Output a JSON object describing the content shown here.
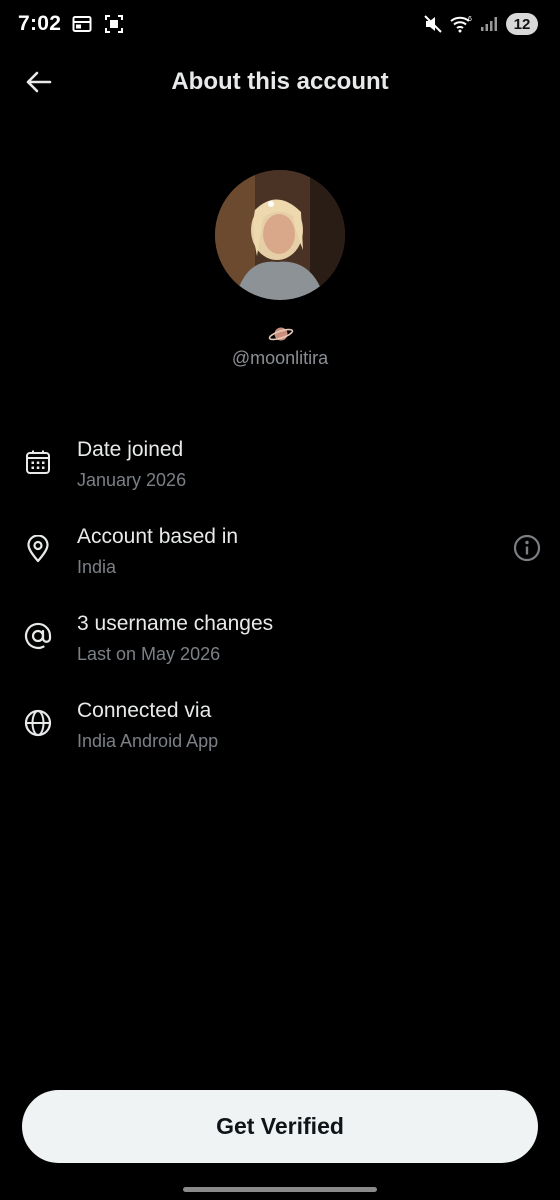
{
  "status_bar": {
    "time": "7:02",
    "battery": "12",
    "icons": [
      "calendar-icon",
      "screen-record-icon",
      "mute-icon",
      "wifi-icon",
      "signal-icon"
    ]
  },
  "header": {
    "title": "About this account",
    "back_icon": "arrow-left-icon"
  },
  "profile": {
    "handle": "@moonlitira",
    "badge_icon": "ringed-planet-icon"
  },
  "rows": [
    {
      "icon": "calendar-icon",
      "title": "Date joined",
      "subtitle": "January 2026"
    },
    {
      "icon": "location-pin-icon",
      "title": "Account based in",
      "subtitle": "India",
      "trailing_icon": "info-icon"
    },
    {
      "icon": "at-sign-icon",
      "title": "3 username changes",
      "subtitle": "Last on May 2026"
    },
    {
      "icon": "globe-icon",
      "title": "Connected via",
      "subtitle": "India Android App"
    }
  ],
  "footer": {
    "button_label": "Get Verified"
  },
  "colors": {
    "background": "#000000",
    "primary_text": "#e7e9ea",
    "secondary_text": "#7b8086",
    "button_bg": "#eff3f4",
    "button_text": "#0f1419"
  }
}
